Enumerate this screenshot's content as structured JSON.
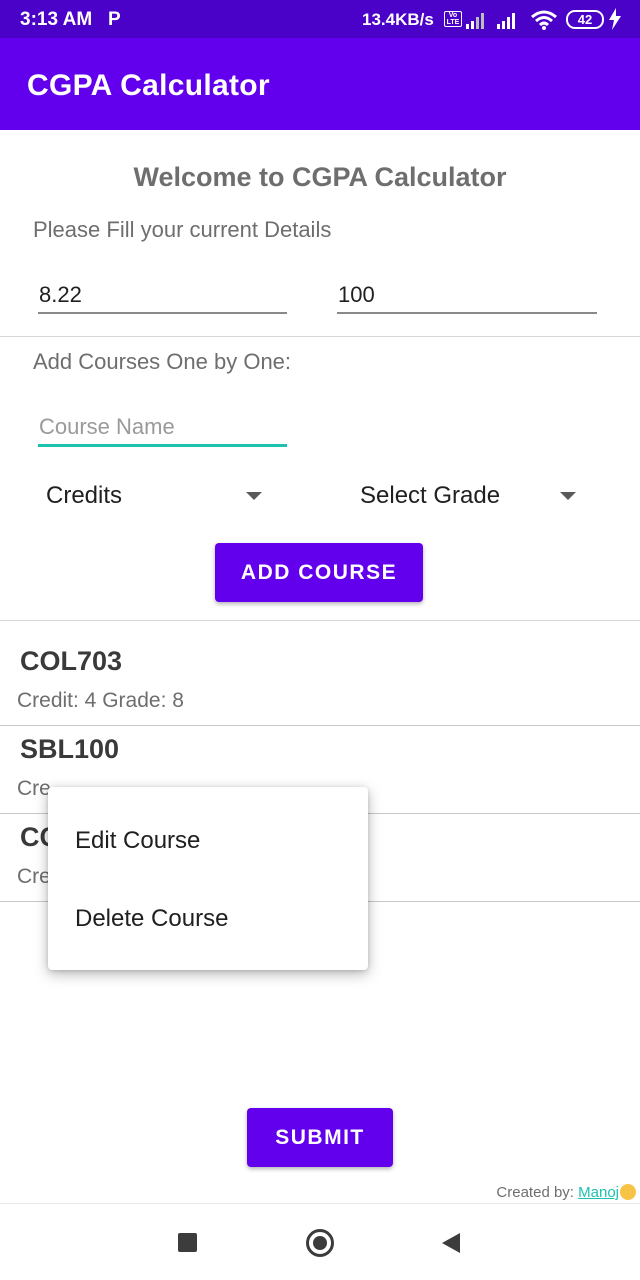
{
  "status_bar": {
    "time": "3:13 AM",
    "notification_icon": "P",
    "network_speed": "13.4KB/s",
    "volte": "Vo LTE",
    "battery": "42"
  },
  "app_bar": {
    "title": "CGPA Calculator"
  },
  "welcome_title": "Welcome to CGPA Calculator",
  "details_label": "Please Fill your current Details",
  "current_cgpa": "8.22",
  "current_credits": "100",
  "add_courses_label": "Add Courses One by One:",
  "course_name_placeholder": "Course Name",
  "credits_spinner": "Credits",
  "grade_spinner": "Select Grade",
  "add_course_button": "ADD COURSE",
  "courses": [
    {
      "name": "COL703",
      "detail": "Credit: 4 Grade: 8"
    },
    {
      "name": "SBL100",
      "detail": "Cre"
    },
    {
      "name": "CC",
      "detail": "Cre"
    }
  ],
  "context_menu": {
    "items": [
      "Edit Course",
      "Delete Course"
    ]
  },
  "submit_button": "SUBMIT",
  "footer": {
    "prefix": "Created by: ",
    "author": "Manoj"
  },
  "colors": {
    "primary": "#6200ee",
    "primary_dark": "#4a02c8",
    "accent": "#1ec1b0"
  }
}
